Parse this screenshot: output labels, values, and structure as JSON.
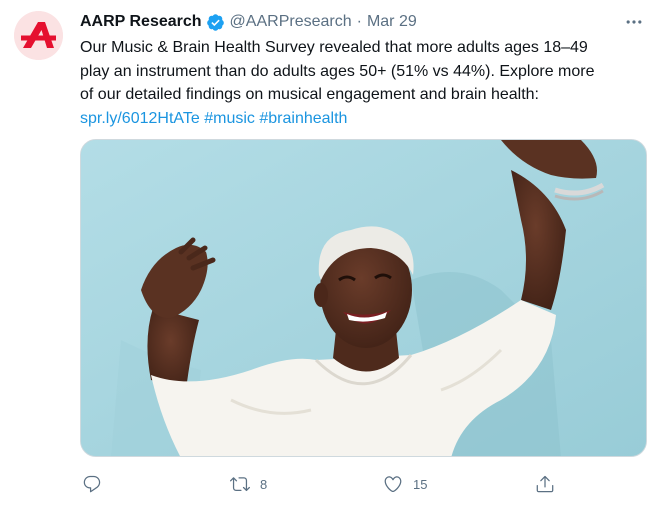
{
  "tweet": {
    "author_name": "AARP Research",
    "handle": "@AARPresearch",
    "separator": "·",
    "date": "Mar 29",
    "text_lines": [
      "Our Music & Brain Health Survey revealed that more adults ages 18–49",
      "play an instrument than do adults ages 50+ (51% vs 44%). Explore more",
      "of our detailed findings on musical engagement and brain health:"
    ],
    "link": "spr.ly/6012HtATe",
    "hashtags": [
      "#music",
      "#brainhealth"
    ],
    "image_alt": "Smiling woman with short white hair in a white shirt raising both arms against a light blue wall"
  },
  "actions": {
    "reply_count": "",
    "retweet_count": "8",
    "like_count": "15"
  },
  "colors": {
    "brand": "#e5102f",
    "link": "#1b95e0",
    "verified": "#1da1f2",
    "secondary_text": "#5b7083",
    "image_background": "#a9d6e0"
  },
  "icons": {
    "avatar": "aarp-logo-icon",
    "verified": "verified-badge-icon",
    "more": "more-dots-icon",
    "reply": "reply-icon",
    "retweet": "retweet-icon",
    "like": "heart-icon",
    "share": "share-icon"
  }
}
